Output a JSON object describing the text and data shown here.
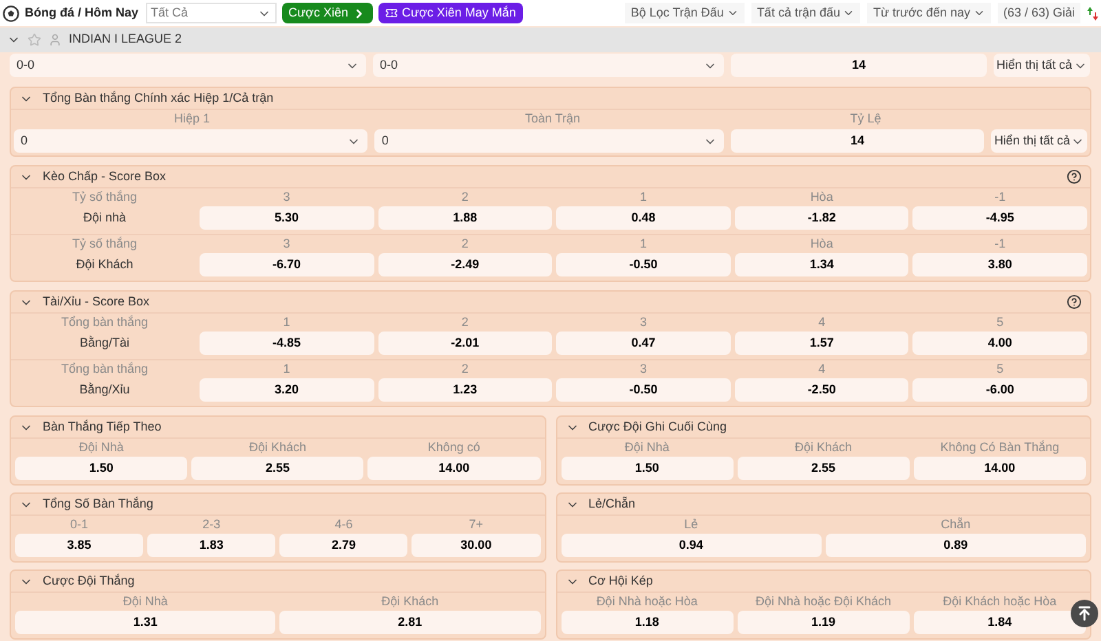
{
  "top_bar": {
    "breadcrumb": "Bóng đá / Hôm Nay",
    "sport_select": "Tất Cả",
    "parlay_button": "Cược Xiên",
    "lucky_button": "Cược Xiên May Mắn",
    "filters": [
      "Bộ Lọc Trận Đấu",
      "Tất cả trận đấu",
      "Từ trước đến nay"
    ],
    "league_count": "(63 / 63) Giải"
  },
  "league": {
    "name": "INDIAN I LEAGUE 2",
    "favorite": false
  },
  "exact_score": {
    "selects": [
      "0-0",
      "0-0"
    ],
    "odds": "14",
    "show_all": "Hiển thị tất cả"
  },
  "exact_total": {
    "title": "Tổng Bàn thắng Chính xác Hiệp 1/Cả trận",
    "columns": [
      "Hiệp 1",
      "Toàn Trận",
      "Tỷ Lệ"
    ],
    "selects": [
      "0",
      "0"
    ],
    "odds": "14",
    "show_all": "Hiển thị tất cả"
  },
  "score_boxes": [
    {
      "title": "Kèo Chấp - Score Box",
      "groups": [
        {
          "label": "Tỷ số thắng",
          "team": "Đội nhà",
          "headers": [
            "3",
            "2",
            "1",
            "Hòa",
            "-1"
          ],
          "odds": [
            "5.30",
            "1.88",
            "0.48",
            "-1.82",
            "-4.95"
          ]
        },
        {
          "label": "Tỷ số thắng",
          "team": "Đội Khách",
          "headers": [
            "3",
            "2",
            "1",
            "Hòa",
            "-1"
          ],
          "odds": [
            "-6.70",
            "-2.49",
            "-0.50",
            "1.34",
            "3.80"
          ]
        }
      ]
    },
    {
      "title": "Tài/Xỉu - Score Box",
      "groups": [
        {
          "label": "Tổng bàn thắng",
          "team": "Bằng/Tài",
          "headers": [
            "1",
            "2",
            "3",
            "4",
            "5"
          ],
          "odds": [
            "-4.85",
            "-2.01",
            "0.47",
            "1.57",
            "4.00"
          ]
        },
        {
          "label": "Tổng bàn thắng",
          "team": "Bằng/Xỉu",
          "headers": [
            "1",
            "2",
            "3",
            "4",
            "5"
          ],
          "odds": [
            "3.20",
            "1.23",
            "-0.50",
            "-2.50",
            "-6.00"
          ]
        }
      ]
    }
  ],
  "markets": [
    {
      "title": "Bàn Thắng Tiếp Theo",
      "options": [
        {
          "label": "Đội Nhà",
          "odds": "1.50"
        },
        {
          "label": "Đội Khách",
          "odds": "2.55"
        },
        {
          "label": "Không có",
          "odds": "14.00"
        }
      ]
    },
    {
      "title": "Cược Đội Ghi Cuối Cùng",
      "options": [
        {
          "label": "Đội Nhà",
          "odds": "1.50"
        },
        {
          "label": "Đội Khách",
          "odds": "2.55"
        },
        {
          "label": "Không Có Bàn Thắng",
          "odds": "14.00"
        }
      ]
    },
    {
      "title": "Tổng Số Bàn Thắng",
      "options": [
        {
          "label": "0-1",
          "odds": "3.85"
        },
        {
          "label": "2-3",
          "odds": "1.83"
        },
        {
          "label": "4-6",
          "odds": "2.79"
        },
        {
          "label": "7+",
          "odds": "30.00"
        }
      ]
    },
    {
      "title": "Lẻ/Chẵn",
      "options": [
        {
          "label": "Lẻ",
          "odds": "0.94"
        },
        {
          "label": "Chẵn",
          "odds": "0.89"
        }
      ]
    },
    {
      "title": "Cược Đội Thắng",
      "options": [
        {
          "label": "Đội Nhà",
          "odds": "1.31"
        },
        {
          "label": "Đội Khách",
          "odds": "2.81"
        }
      ]
    },
    {
      "title": "Cơ Hội Kép",
      "options": [
        {
          "label": "Đội Nhà hoặc Hòa",
          "odds": "1.18"
        },
        {
          "label": "Đội Nhà hoặc Đội Khách",
          "odds": "1.19"
        },
        {
          "label": "Đội Khách hoặc Hòa",
          "odds": "1.84"
        }
      ]
    }
  ]
}
